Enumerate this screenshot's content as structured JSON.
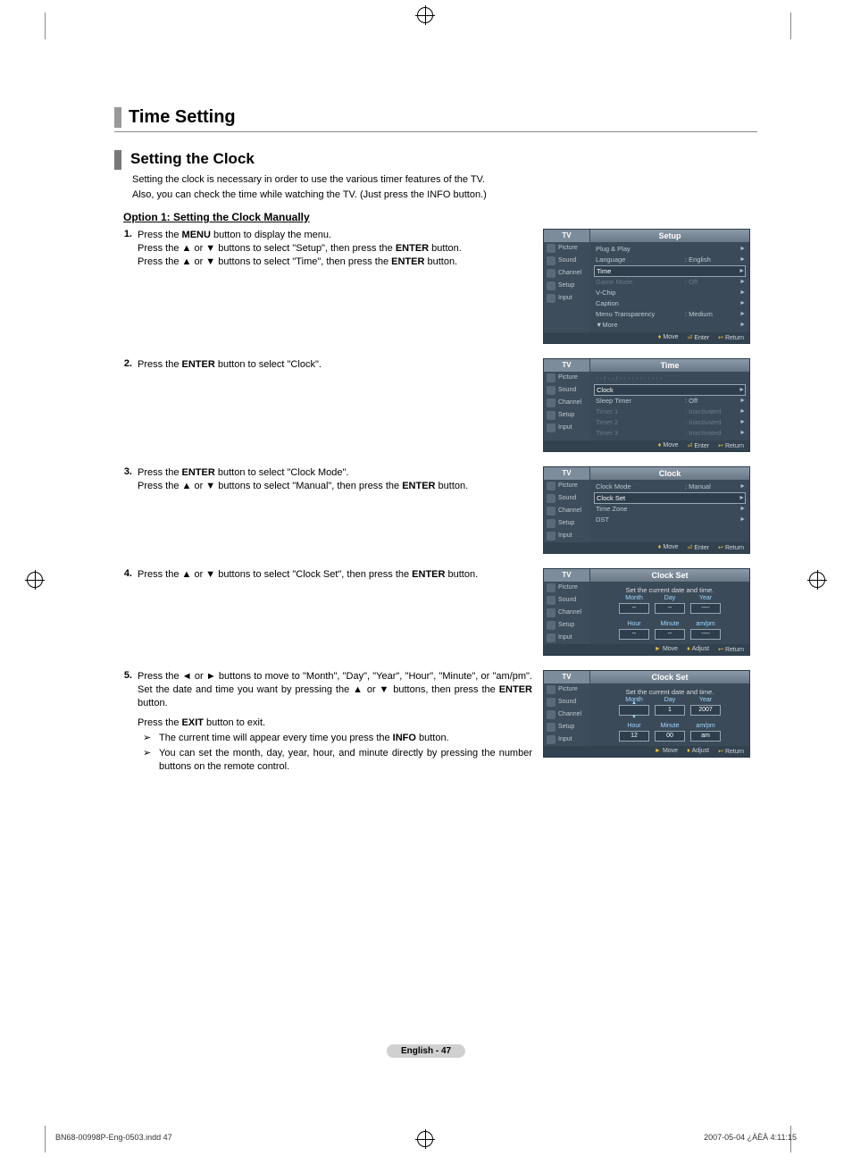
{
  "page": {
    "section_title": "Time Setting",
    "sub_title": "Setting the Clock",
    "intro_line1": "Setting the clock is necessary in order to use the various timer features of the TV.",
    "intro_line2": "Also, you can check the time while watching the TV. (Just press the INFO button.)",
    "option1_title": "Option 1: Setting the Clock Manually",
    "footer": "English - 47",
    "print_left": "BN68-00998P-Eng-0503.indd   47",
    "print_right": "2007-05-04   ¿ÀÈÄ 4:11:15"
  },
  "steps": [
    {
      "n": "1.",
      "lines": [
        "Press the <b>MENU</b> button to display the menu.",
        "Press the ▲ or ▼ buttons to select \"Setup\", then press the <b>ENTER</b> button.",
        "Press the ▲ or ▼ buttons to select \"Time\", then press the <b>ENTER</b> button."
      ]
    },
    {
      "n": "2.",
      "lines": [
        "Press the <b>ENTER</b> button to select \"Clock\"."
      ]
    },
    {
      "n": "3.",
      "lines": [
        "Press the <b>ENTER</b> button to select \"Clock Mode\".",
        "Press the ▲ or ▼ buttons to select \"Manual\", then press the <b>ENTER</b> button."
      ]
    },
    {
      "n": "4.",
      "lines": [
        "Press the ▲ or ▼ buttons to select \"Clock Set\", then press the <b>ENTER</b> button."
      ]
    },
    {
      "n": "5.",
      "lines": [
        "Press the ◄ or ► buttons to move to \"Month\", \"Day\", \"Year\", \"Hour\", \"Minute\", or \"am/pm\". Set the date and time you want by pressing the ▲ or ▼ buttons, then press the <b>ENTER</b> button.",
        "Press the <b>EXIT</b> button to exit."
      ],
      "notes": [
        "The current time will appear every time you press the <b>INFO</b> button.",
        "You can set the month, day, year, hour, and minute directly by pressing the number buttons on the remote control."
      ]
    }
  ],
  "osd_common": {
    "tv_label": "TV",
    "side": [
      "Picture",
      "Sound",
      "Channel",
      "Setup",
      "Input"
    ],
    "foot_move": "Move",
    "foot_enter": "Enter",
    "foot_return": "Return",
    "foot_adjust": "Adjust"
  },
  "osd1": {
    "title": "Setup",
    "rows": [
      {
        "lbl": "Plug & Play",
        "val": "",
        "sel": false,
        "dim": false
      },
      {
        "lbl": "Language",
        "val": ": English",
        "sel": false,
        "dim": false
      },
      {
        "lbl": "Time",
        "val": "",
        "sel": true,
        "dim": false
      },
      {
        "lbl": "Game Mode",
        "val": ": Off",
        "sel": false,
        "dim": true
      },
      {
        "lbl": "V-Chip",
        "val": "",
        "sel": false,
        "dim": false
      },
      {
        "lbl": "Caption",
        "val": "",
        "sel": false,
        "dim": false
      },
      {
        "lbl": "Menu Transparency",
        "val": ": Medium",
        "sel": false,
        "dim": false
      },
      {
        "lbl": "▼More",
        "val": "",
        "sel": false,
        "dim": false
      }
    ]
  },
  "osd2": {
    "title": "Time",
    "header_time": "- - / - - / - - - -   - - : - -  - -",
    "rows": [
      {
        "lbl": "Clock",
        "val": "",
        "sel": true,
        "dim": false
      },
      {
        "lbl": "Sleep Timer",
        "val": ": Off",
        "sel": false,
        "dim": false
      },
      {
        "lbl": "Timer 1",
        "val": ": Inactivated",
        "sel": false,
        "dim": true
      },
      {
        "lbl": "Timer 2",
        "val": ": Inactivated",
        "sel": false,
        "dim": true
      },
      {
        "lbl": "Timer 3",
        "val": ": Inactivated",
        "sel": false,
        "dim": true
      }
    ]
  },
  "osd3": {
    "title": "Clock",
    "rows": [
      {
        "lbl": "Clock Mode",
        "val": ": Manual",
        "sel": false,
        "dim": false
      },
      {
        "lbl": "Clock Set",
        "val": "",
        "sel": true,
        "dim": false
      },
      {
        "lbl": "Time Zone",
        "val": "",
        "sel": false,
        "dim": false
      },
      {
        "lbl": "DST",
        "val": "",
        "sel": false,
        "dim": false
      }
    ]
  },
  "osd4": {
    "title": "Clock Set",
    "hint": "Set the current date and time.",
    "headers1": [
      "Month",
      "Day",
      "Year"
    ],
    "values1": [
      "--",
      "--",
      "----"
    ],
    "headers2": [
      "Hour",
      "Minute",
      "am/pm"
    ],
    "values2": [
      "--",
      "--",
      "----"
    ]
  },
  "osd5": {
    "title": "Clock Set",
    "hint": "Set the current date and time.",
    "headers1": [
      "Month",
      "Day",
      "Year"
    ],
    "values1": [
      "",
      "1",
      "2007"
    ],
    "headers2": [
      "Hour",
      "Minute",
      "am/pm"
    ],
    "values2": [
      "12",
      "00",
      "am"
    ]
  }
}
